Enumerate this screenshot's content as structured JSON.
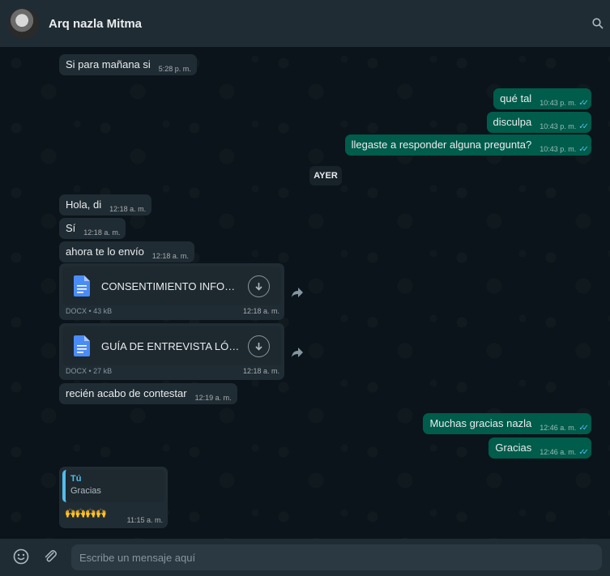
{
  "header": {
    "contact_name": "Arq nazla Mitma"
  },
  "messages": [
    {
      "dir": "in",
      "text": "Si para mañana si",
      "time": "5:28 p. m."
    },
    {
      "dir": "out",
      "text": "qué tal",
      "time": "10:43 p. m."
    },
    {
      "dir": "out",
      "text": "disculpa",
      "time": "10:43 p. m."
    },
    {
      "dir": "out",
      "text": "llegaste a responder alguna pregunta?",
      "time": "10:43 p. m."
    },
    {
      "dir": "in",
      "text": "Hola, di",
      "time": "12:18 a. m."
    },
    {
      "dir": "in",
      "text": "Sí",
      "time": "12:18 a. m."
    },
    {
      "dir": "in",
      "text": "ahora te lo envío",
      "time": "12:18 a. m."
    },
    {
      "dir": "in",
      "text": "recién acabo de contestar",
      "time": "12:19 a. m."
    },
    {
      "dir": "out",
      "text": "Muchas gracias nazla",
      "time": "12:46 a. m."
    },
    {
      "dir": "out",
      "text": "Gracias",
      "time": "12:46 a. m."
    }
  ],
  "date_divider": "AYER",
  "documents": [
    {
      "name": "CONSENTIMIENTO INFORMAD...",
      "meta": "DOCX • 43 kB",
      "time": "12:18 a. m."
    },
    {
      "name": "GUÍA DE ENTREVISTA LÓPEZ D ...",
      "meta": "DOCX • 27 kB",
      "time": "12:18 a. m."
    }
  ],
  "reply": {
    "quoted_author": "Tú",
    "quoted_text": "Gracias",
    "emojis": "🙌🙌🙌🙌",
    "time": "11:15 a. m."
  },
  "composer": {
    "placeholder": "Escribe un mensaje aquí"
  },
  "icons": {
    "search": "search-icon",
    "emoji": "emoji-icon",
    "attach": "paperclip-icon",
    "forward": "forward-icon",
    "download": "download-icon",
    "document": "document-icon",
    "read_receipt": "double-check-icon"
  },
  "colors": {
    "incoming_bubble": "#202c33",
    "outgoing_bubble": "#005c4b",
    "read_tick": "#53bdeb",
    "background": "#0b141a"
  }
}
